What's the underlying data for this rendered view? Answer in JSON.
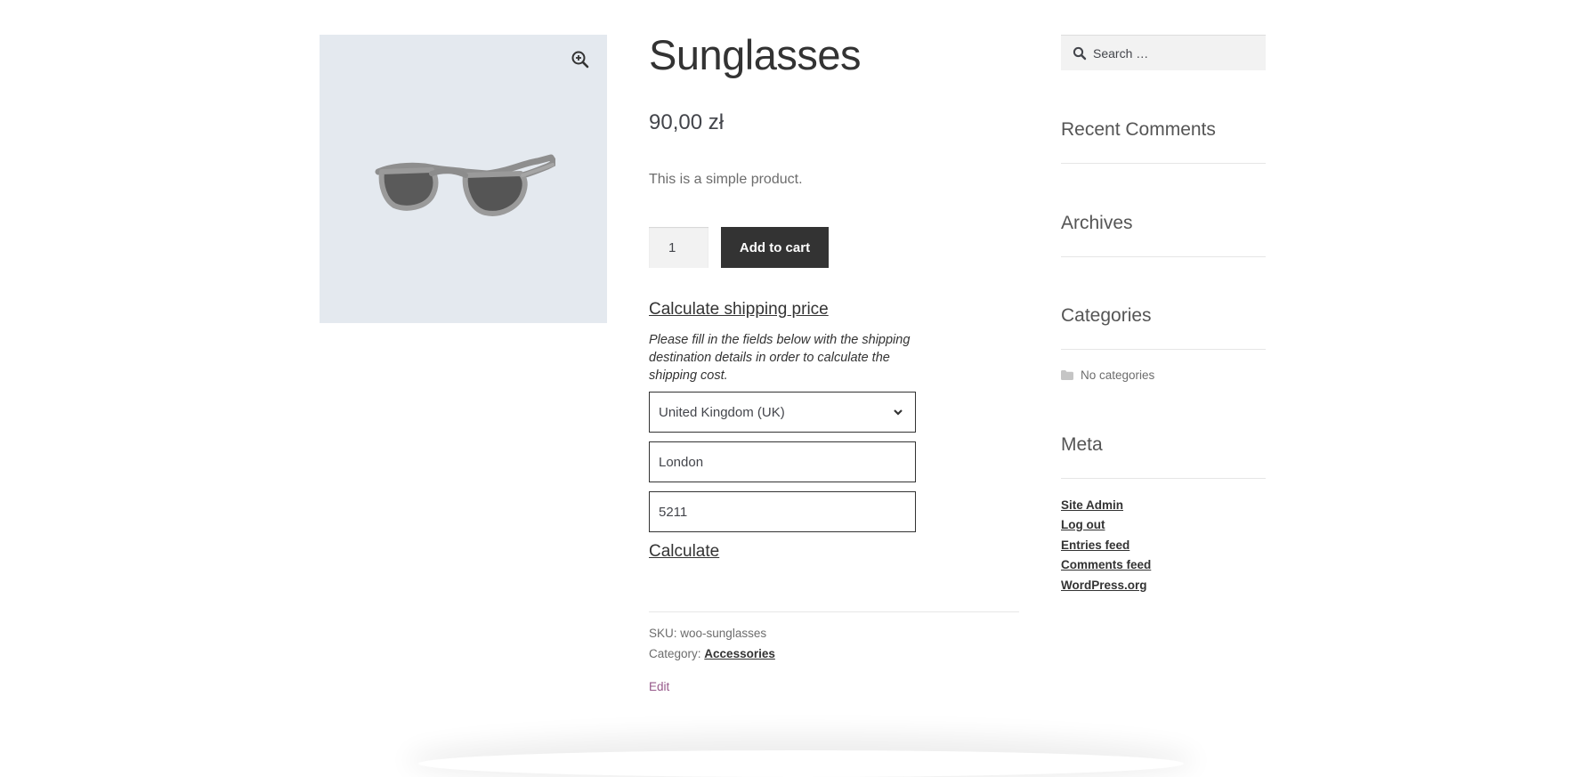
{
  "product": {
    "title": "Sunglasses",
    "price": "90,00 zł",
    "description": "This is a simple product.",
    "quantity": "1",
    "add_to_cart": "Add to cart"
  },
  "shipping": {
    "link": "Calculate shipping price",
    "note": "Please fill in the fields below with the shipping destination details in order to calculate the shipping cost.",
    "country": "United Kingdom (UK)",
    "city": "London",
    "postcode": "5211",
    "calculate": "Calculate"
  },
  "meta": {
    "sku_label": "SKU:",
    "sku_value": "woo-sunglasses",
    "category_label": "Category:",
    "category_value": "Accessories",
    "edit": "Edit"
  },
  "sidebar": {
    "search_placeholder": "Search …",
    "recent_comments": "Recent Comments",
    "archives": "Archives",
    "categories": "Categories",
    "no_categories": "No categories",
    "meta": "Meta",
    "meta_links": [
      "Site Admin",
      "Log out",
      "Entries feed",
      "Comments feed",
      "WordPress.org"
    ]
  },
  "icons": {
    "zoom": "zoom-in-icon",
    "search": "search-icon",
    "folder": "folder-icon",
    "chevron": "chevron-down-icon"
  },
  "colors": {
    "button_bg": "#333333",
    "gallery_bg": "#e4e9ef",
    "edit_link": "#96588a"
  }
}
